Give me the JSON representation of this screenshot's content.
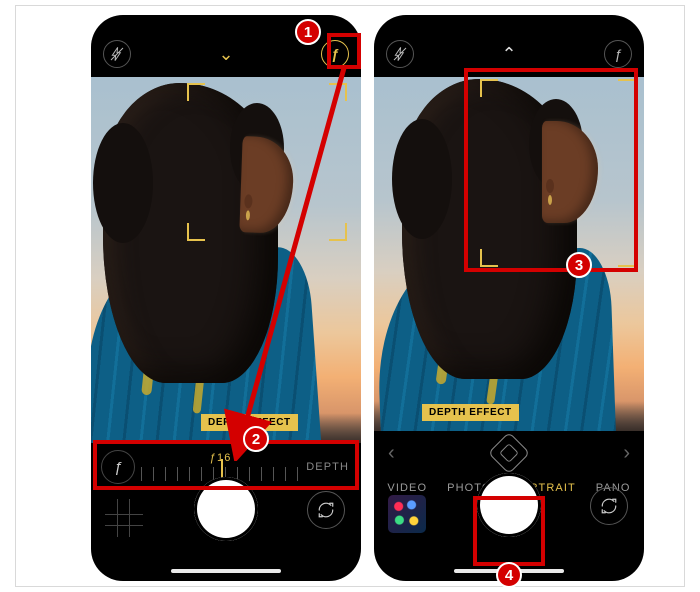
{
  "left": {
    "topbar": {
      "flash": "⊘",
      "chevron": "⌄",
      "f_button": "ƒ"
    },
    "badge": "DEPTH EFFECT",
    "depth": {
      "f_button": "ƒ",
      "value": "ƒ16",
      "label": "DEPTH"
    },
    "controls": {
      "flip": "↻"
    }
  },
  "right": {
    "topbar": {
      "flash": "⊘",
      "chevron": "⌃",
      "f_button": "ƒ"
    },
    "badge": "DEPTH EFFECT",
    "fx": {
      "left": "‹",
      "right": "›"
    },
    "modes": {
      "video": "VIDEO",
      "photo": "PHOTO",
      "portrait": "PORTRAIT",
      "pano": "PANO"
    },
    "controls": {
      "flip": "↻"
    }
  },
  "anno": {
    "n1": "1",
    "n2": "2",
    "n3": "3",
    "n4": "4"
  }
}
